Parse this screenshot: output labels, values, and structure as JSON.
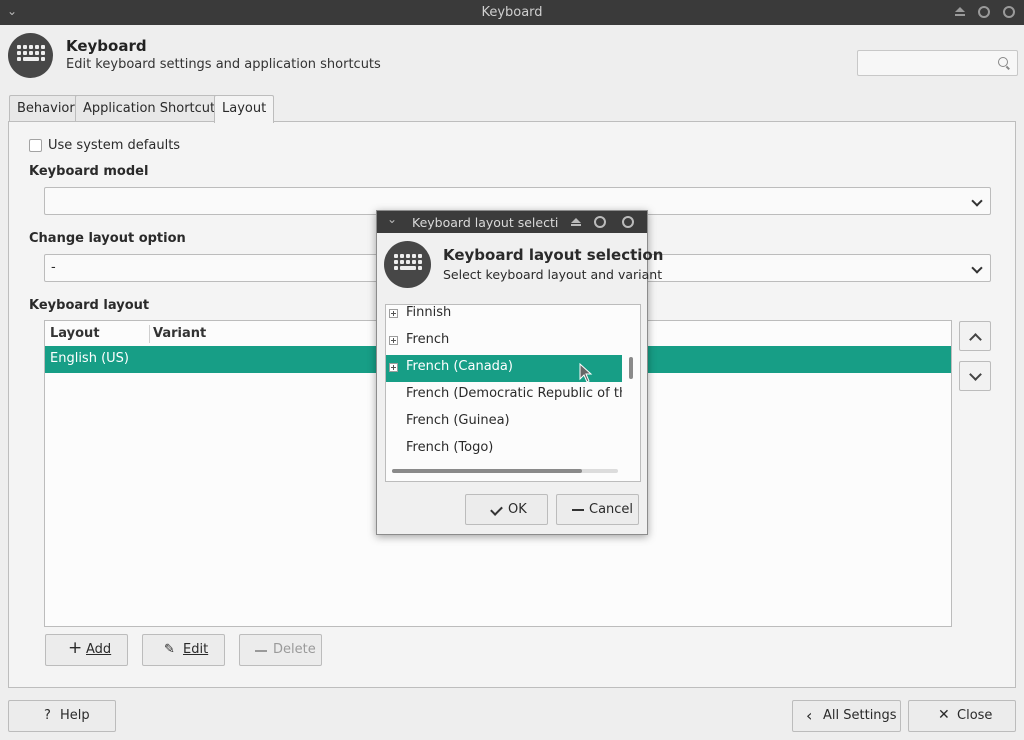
{
  "window": {
    "title": "Keyboard"
  },
  "header": {
    "title": "Keyboard",
    "subtitle": "Edit keyboard settings and application shortcuts",
    "search_placeholder": ""
  },
  "tabs": [
    {
      "label": "Behavior",
      "active": false
    },
    {
      "label": "Application Shortcuts",
      "active": false
    },
    {
      "label": "Layout",
      "active": true
    }
  ],
  "layout_tab": {
    "use_system_defaults": {
      "label": "Use system defaults",
      "checked": false
    },
    "keyboard_model": {
      "label": "Keyboard model",
      "value": ""
    },
    "change_layout_option": {
      "label": "Change layout option",
      "value": "-"
    },
    "keyboard_layout": {
      "label": "Keyboard layout",
      "columns": [
        "Layout",
        "Variant"
      ],
      "rows": [
        {
          "layout": "English (US)",
          "variant": "",
          "selected": true
        }
      ]
    },
    "buttons": {
      "add": "Add",
      "edit": "Edit",
      "delete": "Delete"
    }
  },
  "footer": {
    "help": "Help",
    "all_settings": "All Settings",
    "close": "Close"
  },
  "dialog": {
    "window_title": "Keyboard layout selection",
    "title": "Keyboard layout selection",
    "subtitle": "Select keyboard layout and variant",
    "items": [
      {
        "label": "Finnish",
        "expandable": true,
        "selected": false
      },
      {
        "label": "French",
        "expandable": true,
        "selected": false
      },
      {
        "label": "French (Canada)",
        "expandable": true,
        "selected": true
      },
      {
        "label": "French (Democratic Republic of the Congo)",
        "expandable": false,
        "selected": false
      },
      {
        "label": "French (Guinea)",
        "expandable": false,
        "selected": false
      },
      {
        "label": "French (Togo)",
        "expandable": false,
        "selected": false
      }
    ],
    "horizontal_scroll_fraction": 0.84,
    "ok": "OK",
    "cancel": "Cancel"
  },
  "colors": {
    "accent": "#179e86",
    "titlebar": "#3a3a3a",
    "icon_bg": "#474747"
  }
}
